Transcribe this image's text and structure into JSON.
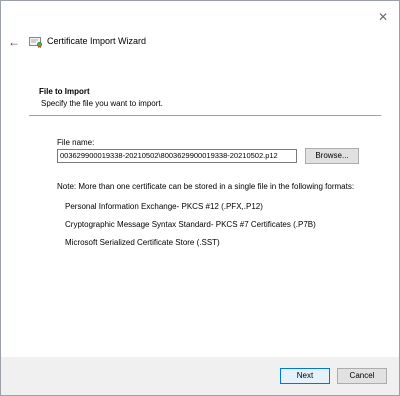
{
  "window": {
    "title": "Certificate Import Wizard",
    "close_glyph": "✕",
    "back_glyph": "←"
  },
  "page": {
    "heading": "File to Import",
    "subheading": "Specify the file you want to import."
  },
  "file": {
    "label": "File name:",
    "value": "003629900019338-20210502\\8003629900019338-20210502.p12",
    "browse_label": "Browse..."
  },
  "note": {
    "intro": "Note:  More than one certificate can be stored in a single file in the following formats:",
    "formats": [
      "Personal Information Exchange- PKCS #12 (.PFX,.P12)",
      "Cryptographic Message Syntax Standard- PKCS #7 Certificates (.P7B)",
      "Microsoft Serialized Certificate Store (.SST)"
    ]
  },
  "buttons": {
    "next": "Next",
    "cancel": "Cancel"
  },
  "icons": {
    "wizard": "certificate-icon",
    "back": "back-arrow-icon",
    "close": "close-icon"
  }
}
